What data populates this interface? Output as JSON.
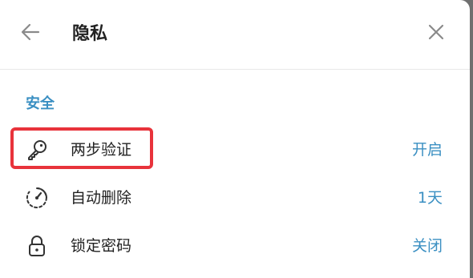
{
  "header": {
    "title": "隐私",
    "back_icon": "arrow-left-icon",
    "close_icon": "close-icon"
  },
  "section": {
    "title": "安全"
  },
  "rows": [
    {
      "label": "两步验证",
      "value": "开启",
      "icon": "key-icon"
    },
    {
      "label": "自动删除",
      "value": "1天",
      "icon": "timer-icon"
    },
    {
      "label": "锁定密码",
      "value": "关闭",
      "icon": "lock-icon"
    }
  ],
  "colors": {
    "accent": "#3a8fc2",
    "highlight": "#e8333b",
    "text": "#222222",
    "icon": "#333333"
  }
}
